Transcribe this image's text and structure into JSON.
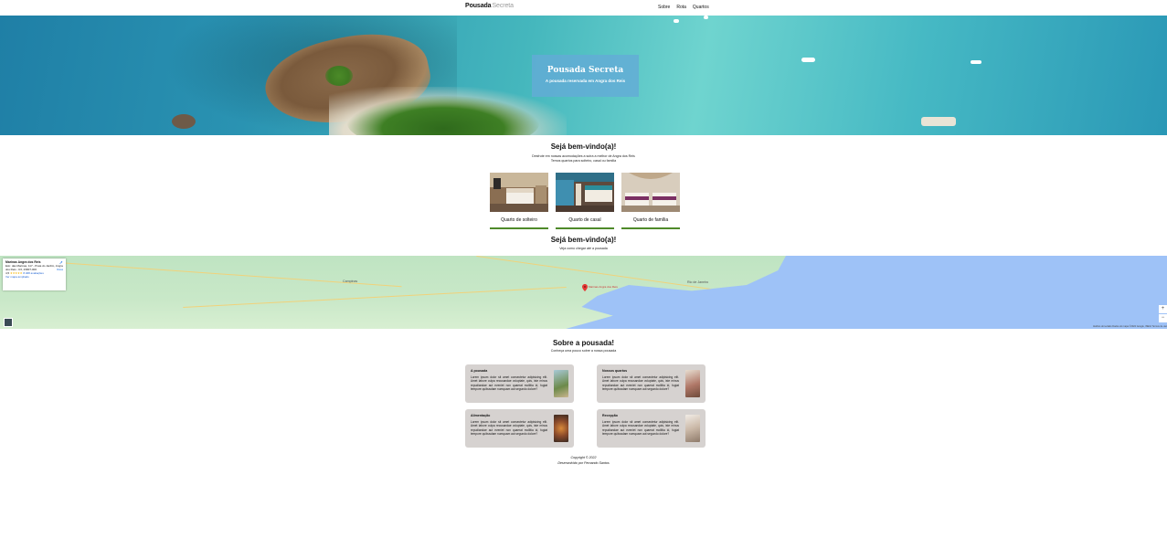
{
  "nav": {
    "brand_primary": "Pousada",
    "brand_secondary": "Secreta",
    "links": [
      "Sobre",
      "Rota",
      "Quartos"
    ]
  },
  "hero": {
    "title": "Pousada Secreta",
    "subtitle": "A pousada reservada em Angra dos Reis"
  },
  "welcome": {
    "title": "Sejá bem-vindo(a)!",
    "line1": "Desfrute em nossas acomodações a sutra a melhor de Angra dos Reis",
    "line2": "Temos quartos para solteiro, casal ou família"
  },
  "rooms": [
    {
      "label": "Quarto de solteiro"
    },
    {
      "label": "Quarto de casal"
    },
    {
      "label": "Quarto de família"
    }
  ],
  "route": {
    "title": "Sejá bem-vindo(a)!",
    "subtitle": "Veja como chegar até a pousada"
  },
  "map": {
    "info_title": "Marinas Angra dos Reis",
    "info_address": "Estr. das Marinas, 117 - Praia do Jardim, Angra dos Reis - RJ, 23907-000",
    "info_rating": "4,5",
    "info_reviews": "8.468 avaliações",
    "info_link": "Ver mapa ampliado",
    "directions": "Rotas",
    "place_label": "Marinas Angra dos Reis",
    "city_campinas": "Campinas",
    "city_rio": "Rio de Janeiro",
    "zoom_in": "+",
    "zoom_out": "−",
    "attribution": "Atalhos do teclado   Dados do mapa ©2022 Google, INEGI   Termos de uso"
  },
  "about": {
    "title": "Sobre a pousada!",
    "subtitle": "Conheça uma pouco sobre a nossa pousada"
  },
  "cards": [
    {
      "title": "A pousada",
      "body": "Lorem ipsum dolor sit amet consectetur adipisicing elit. Amet labore culpa recusandae voluptate, quis, iste minus repudiandae aut eveniet non quaerat mollitia id, fugiat tempore quibusdam numquam aut segundo dolore?"
    },
    {
      "title": "Nossos quartos",
      "body": "Lorem ipsum dolor sit amet consectetur adipisicing elit. Amet labore culpa recusandae voluptate, quis, iste minus repudiandae aut eveniet non quaerat mollitia id, fugiat tempore quibusdam numquam aut segundo dolore?"
    },
    {
      "title": "Alimentação",
      "body": "Lorem ipsum dolor sit amet consectetur adipisicing elit. Amet labore culpa recusandae voluptate, quis, iste minus repudiandae aut eveniet non quaerat mollitia id, fugiat tempore quibusdam numquam aut segundo dolore?"
    },
    {
      "title": "Recepção",
      "body": "Lorem ipsum dolor sit amet consectetur adipisicing elit. Amet labore culpa recusandae voluptate, quis, iste minus repudiandae aut eveniet non quaerat mollitia id, fugiat tempore quibusdam numquam aut segundo dolore?"
    }
  ],
  "footer": {
    "copyright": "Copyright © 2022",
    "credit": "Desenvolvido por Fernando Santos"
  },
  "colors": {
    "accent_line": "#4f8a2a",
    "card_bg": "#d6d2d0",
    "hero_box": "#64aad7"
  }
}
